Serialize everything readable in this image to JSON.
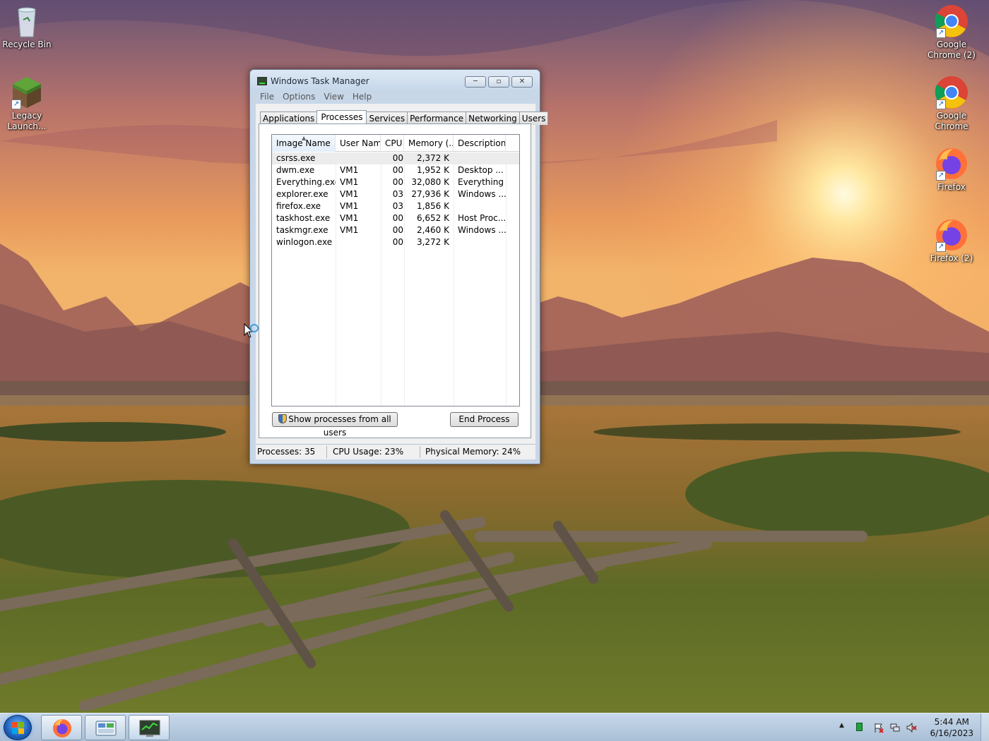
{
  "desktop": {
    "icons_left": [
      {
        "label": "Recycle Bin",
        "icon": "recycle-bin-icon"
      },
      {
        "label": "Legacy Launch...",
        "icon": "minecraft-grass-block-icon"
      }
    ],
    "icons_right": [
      {
        "label": "Google Chrome (2)",
        "icon": "chrome-icon"
      },
      {
        "label": "Google Chrome",
        "icon": "chrome-icon"
      },
      {
        "label": "Firefox",
        "icon": "firefox-icon"
      },
      {
        "label": "Firefox (2)",
        "icon": "firefox-icon"
      }
    ]
  },
  "window": {
    "title": "Windows Task Manager",
    "controls": {
      "minimize": "─",
      "maximize": "▫",
      "close": "✕"
    },
    "menu": [
      "File",
      "Options",
      "View",
      "Help"
    ],
    "tabs": [
      "Applications",
      "Processes",
      "Services",
      "Performance",
      "Networking",
      "Users"
    ],
    "active_tab": "Processes",
    "columns": [
      "Image Name",
      "User Name",
      "CPU",
      "Memory (...",
      "Description"
    ],
    "sorted_column": "Image Name",
    "processes": [
      {
        "name": "csrss.exe",
        "user": "",
        "cpu": "00",
        "memory": "2,372 K",
        "description": ""
      },
      {
        "name": "dwm.exe",
        "user": "VM1",
        "cpu": "00",
        "memory": "1,952 K",
        "description": "Desktop ..."
      },
      {
        "name": "Everything.exe",
        "user": "VM1",
        "cpu": "00",
        "memory": "32,080 K",
        "description": "Everything"
      },
      {
        "name": "explorer.exe",
        "user": "VM1",
        "cpu": "03",
        "memory": "27,936 K",
        "description": "Windows ..."
      },
      {
        "name": "firefox.exe",
        "user": "VM1",
        "cpu": "03",
        "memory": "1,856 K",
        "description": ""
      },
      {
        "name": "taskhost.exe",
        "user": "VM1",
        "cpu": "00",
        "memory": "6,652 K",
        "description": "Host Proc..."
      },
      {
        "name": "taskmgr.exe",
        "user": "VM1",
        "cpu": "00",
        "memory": "2,460 K",
        "description": "Windows ..."
      },
      {
        "name": "winlogon.exe",
        "user": "",
        "cpu": "00",
        "memory": "3,272 K",
        "description": ""
      }
    ],
    "selected_row": 0,
    "buttons": {
      "show_all_users": "Show processes from all users",
      "end_process": "End Process"
    },
    "status": {
      "processes": "Processes: 35",
      "cpu": "CPU Usage: 23%",
      "memory": "Physical Memory: 24%"
    }
  },
  "taskbar": {
    "pinned": [
      "firefox-icon",
      "control-panel-icon",
      "task-manager-icon"
    ],
    "active": "task-manager-icon",
    "tray": {
      "show_hidden": "▲"
    },
    "clock": {
      "time": "5:44 AM",
      "date": "6/16/2023"
    }
  },
  "colors": {
    "window_frame": "#c8d7e8",
    "taskbar": "#b8cce0",
    "sky_top": "#6b5a7a",
    "sun": "#fff4c0"
  }
}
